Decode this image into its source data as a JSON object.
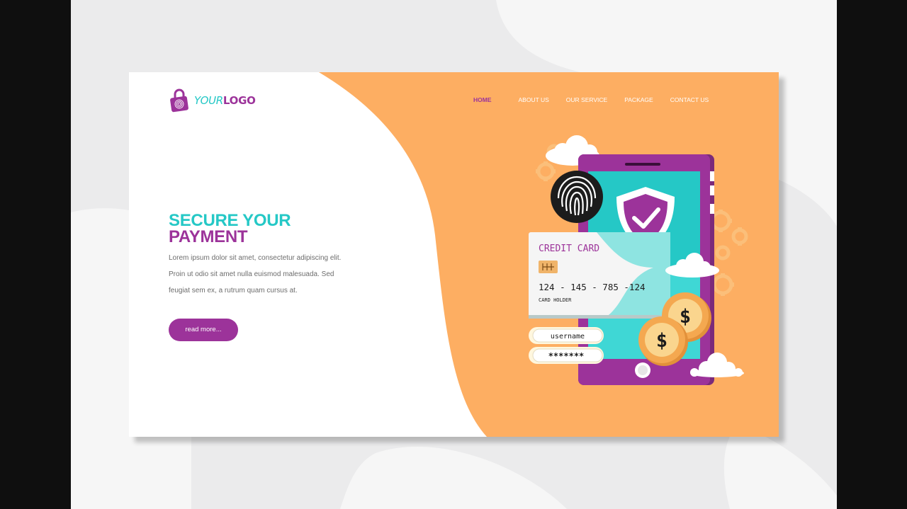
{
  "brand": {
    "logo_prefix": "YOUR",
    "logo_suffix": "LOGO"
  },
  "nav": {
    "items": [
      {
        "label": "HOME",
        "active": true
      },
      {
        "label": "ABOUT US",
        "active": false
      },
      {
        "label": "OUR SERVICE",
        "active": false
      },
      {
        "label": "PACKAGE",
        "active": false
      },
      {
        "label": "CONTACT US",
        "active": false
      }
    ]
  },
  "hero": {
    "title_line1": "SECURE YOUR",
    "title_line2": "PAYMENT",
    "body_lines": [
      "Lorem ipsum dolor sit amet, consectetur adipiscing elit.",
      "Proin ut odio sit amet nulla euismod malesuada. Sed",
      "feugiat sem ex, a rutrum quam cursus at."
    ],
    "cta_label": "read more..."
  },
  "illustration": {
    "card_title": "CREDIT CARD",
    "card_number": "124 - 145 - 785 -124",
    "card_holder": "CARD HOLDER",
    "username_field": "username",
    "password_field": "*******",
    "coin_symbol": "$"
  },
  "colors": {
    "orange": "#fdae62",
    "purple": "#9c339a",
    "teal": "#25c8c6",
    "white": "#ffffff"
  },
  "icons": [
    "padlock-fingerprint-icon",
    "fingerprint-icon",
    "shield-check-icon",
    "gear-icon",
    "cloud-icon",
    "coin-icon"
  ]
}
